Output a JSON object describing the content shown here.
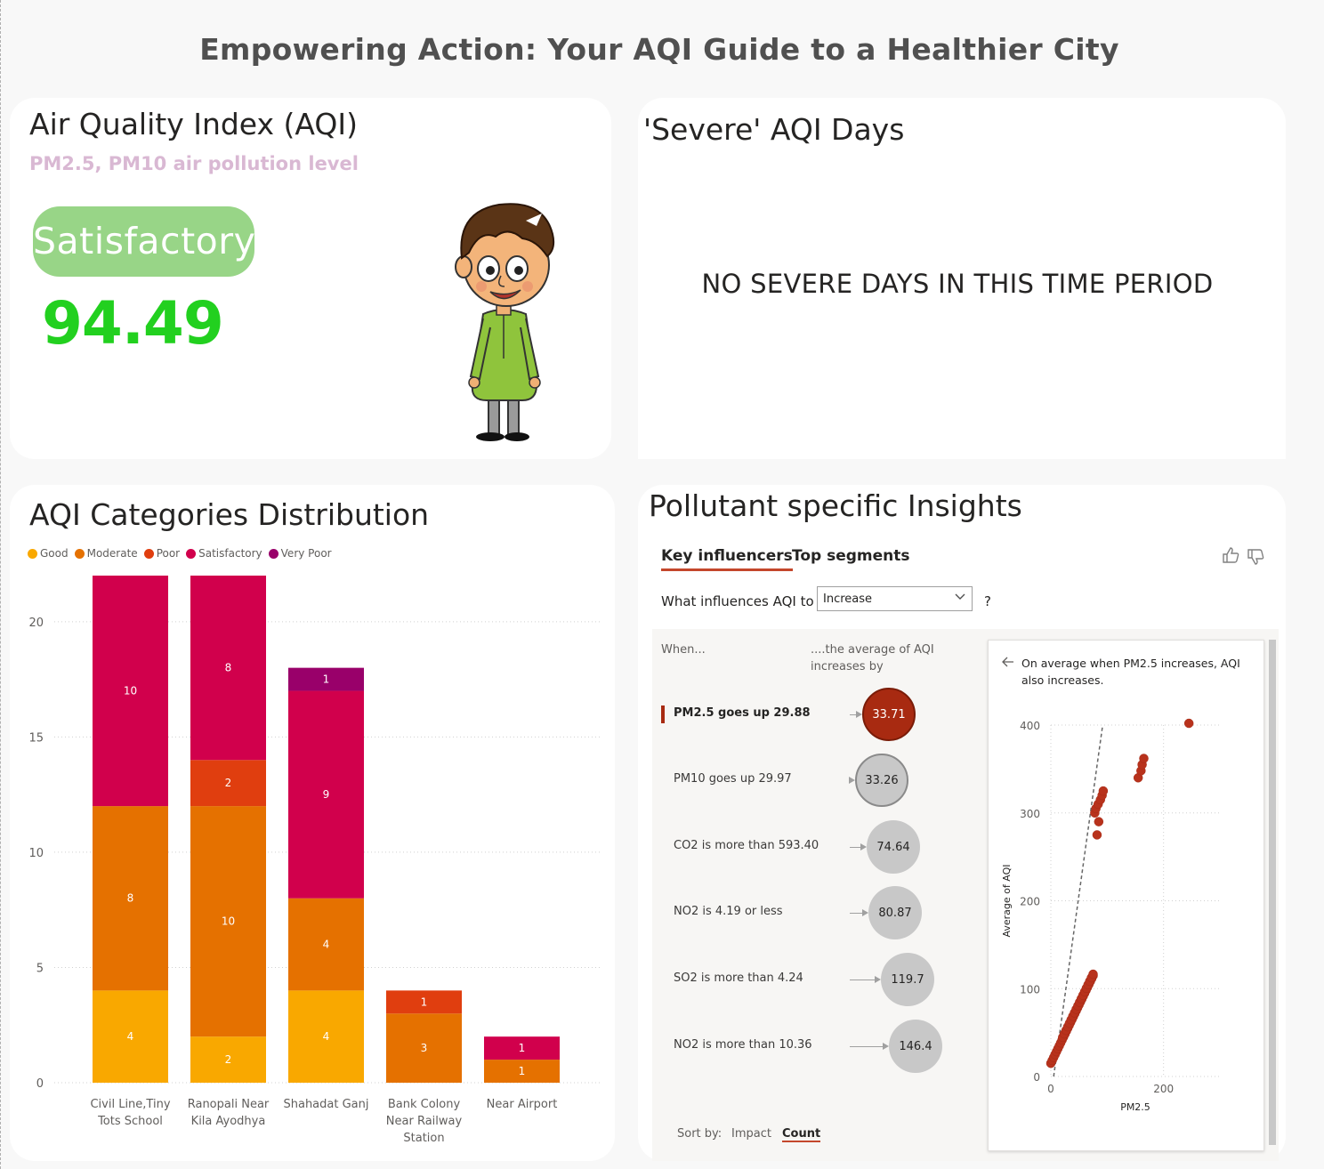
{
  "title": "Empowering Action: Your AQI Guide to a Healthier City",
  "aqi_card": {
    "title": "Air Quality Index (AQI)",
    "subtitle": "PM2.5, PM10 air pollution level",
    "status": "Satisfactory",
    "value": "94.49",
    "colors": {
      "pill": "#98d587",
      "value": "#22d01f"
    }
  },
  "severe_card": {
    "title": "'Severe' AQI Days",
    "message": "NO SEVERE DAYS IN THIS TIME PERIOD"
  },
  "distribution_card": {
    "title": "AQI Categories Distribution",
    "legend": [
      {
        "label": "Good",
        "color": "#f9a800"
      },
      {
        "label": "Moderate",
        "color": "#e57100"
      },
      {
        "label": "Poor",
        "color": "#e03e0f"
      },
      {
        "label": "Satisfactory",
        "color": "#d1004c"
      },
      {
        "label": "Very Poor",
        "color": "#99006a"
      }
    ]
  },
  "chart_data": {
    "type": "bar",
    "stacked": true,
    "categories": [
      [
        "Civil Line,Tiny",
        "Tots School"
      ],
      [
        "Ranopali Near",
        "Kila Ayodhya"
      ],
      [
        "Shahadat Ganj"
      ],
      [
        "Bank Colony",
        "Near Railway",
        "Station"
      ],
      [
        "Near Airport"
      ]
    ],
    "series": [
      {
        "name": "Good",
        "color": "#f9a800",
        "values": [
          4,
          2,
          4,
          0,
          0
        ]
      },
      {
        "name": "Moderate",
        "color": "#e57100",
        "values": [
          8,
          10,
          4,
          3,
          1
        ]
      },
      {
        "name": "Poor",
        "color": "#e03e0f",
        "values": [
          0,
          2,
          0,
          1,
          0
        ]
      },
      {
        "name": "Satisfactory",
        "color": "#d1004c",
        "values": [
          10,
          8,
          9,
          0,
          1
        ]
      },
      {
        "name": "Very Poor",
        "color": "#99006a",
        "values": [
          0,
          0,
          1,
          0,
          0
        ]
      }
    ],
    "yticks": [
      0,
      5,
      10,
      15,
      20
    ],
    "ylim": [
      0,
      22
    ],
    "grid": true,
    "legend_position": "top-left"
  },
  "insights_card": {
    "title": "Pollutant specific Insights",
    "tabs": [
      "Key influencers",
      "Top segments"
    ],
    "question_label": "What influences AQI to",
    "dropdown_value": "Increase",
    "question_mark": "?",
    "head_when": "When...",
    "head_avg": "....the average of AQI increases by",
    "influencers": [
      {
        "label": "PM2.5 goes up 29.88",
        "value": "33.71",
        "selected": true
      },
      {
        "label": "PM10 goes up 29.97",
        "value": "33.26",
        "selected": false
      },
      {
        "label": "CO2 is more than 593.40",
        "value": "74.64",
        "selected": false
      },
      {
        "label": "NO2 is 4.19 or less",
        "value": "80.87",
        "selected": false
      },
      {
        "label": "SO2 is more than 4.24",
        "value": "119.7",
        "selected": false
      },
      {
        "label": "NO2 is more than 10.36",
        "value": "146.4",
        "selected": false
      }
    ],
    "sort_by": "Sort by:",
    "sort_options": [
      "Impact",
      "Count"
    ],
    "detail_text": "On average when PM2.5 increases, AQI also increases.",
    "scatter": {
      "xlabel": "PM2.5",
      "ylabel": "Average of AQI",
      "xticks": [
        0,
        200
      ],
      "yticks": [
        0,
        100,
        200,
        300,
        400
      ],
      "xlim": [
        0,
        300
      ],
      "ylim": [
        0,
        400
      ]
    }
  }
}
